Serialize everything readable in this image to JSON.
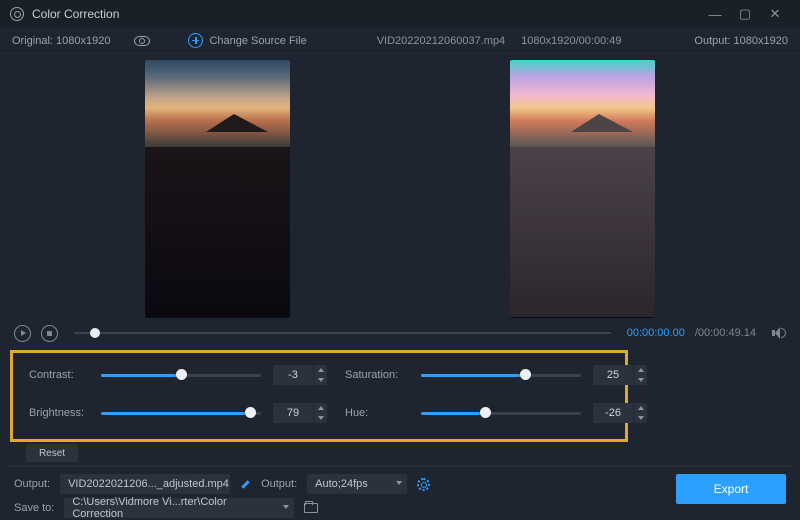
{
  "titlebar": {
    "title": "Color Correction"
  },
  "info": {
    "original_label": "Original: 1080x1920",
    "change_source_label": "Change Source File",
    "filename": "VID20220212060037.mp4",
    "dims_duration": "1080x1920/00:00:49",
    "output_label": "Output: 1080x1920"
  },
  "playback": {
    "current": "00:00:00.00",
    "total": "/00:00:49.14"
  },
  "sliders": {
    "contrast": {
      "label": "Contrast:",
      "value": "-3",
      "fill_pct": 47,
      "knob_pct": 47
    },
    "saturation": {
      "label": "Saturation:",
      "value": "25",
      "fill_pct": 62,
      "knob_pct": 62
    },
    "brightness": {
      "label": "Brightness:",
      "value": "79",
      "fill_pct": 90,
      "knob_pct": 90
    },
    "hue": {
      "label": "Hue:",
      "value": "-26",
      "fill_pct": 37,
      "knob_pct": 37
    }
  },
  "reset_label": "Reset",
  "output": {
    "row1_label": "Output:",
    "filename_adjusted": "VID2022021206..._adjusted.mp4",
    "row1_label2": "Output:",
    "format": "Auto;24fps",
    "save_label": "Save to:",
    "save_path": "C:\\Users\\Vidmore Vi...rter\\Color Correction"
  },
  "export_label": "Export"
}
